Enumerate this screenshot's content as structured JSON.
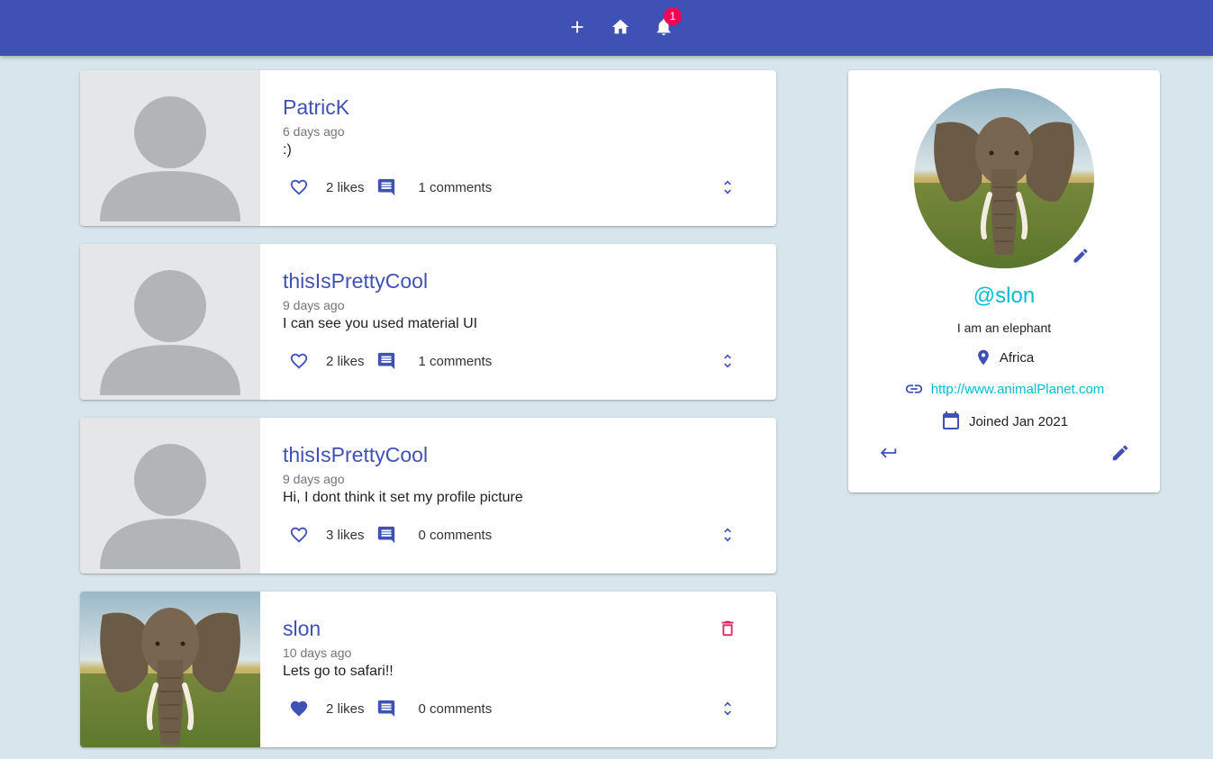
{
  "appbar": {
    "notification_count": "1",
    "icons": [
      "add-icon",
      "home-icon",
      "bell-icon"
    ],
    "color": "#3f51b5"
  },
  "posts": [
    {
      "user": "PatricK",
      "date": "6 days ago",
      "body": ":)",
      "likes": "2 likes",
      "comments": "1 comments",
      "liked": false,
      "owner": false
    },
    {
      "user": "thisIsPrettyCool",
      "date": "9 days ago",
      "body": "I can see you used material UI",
      "likes": "2 likes",
      "comments": "1 comments",
      "liked": false,
      "owner": false
    },
    {
      "user": "thisIsPrettyCool",
      "date": "9 days ago",
      "body": "Hi, I dont think it set my profile picture",
      "likes": "3 likes",
      "comments": "0 comments",
      "liked": false,
      "owner": false
    },
    {
      "user": "slon",
      "date": "10 days ago",
      "body": "Lets go to safari!!",
      "likes": "2 likes",
      "comments": "0 comments",
      "liked": true,
      "owner": true
    }
  ],
  "profile": {
    "handle": "@slon",
    "bio": "I am an elephant",
    "location": "Africa",
    "website": "http://www.animalPlanet.com",
    "joined": "Joined Jan 2021"
  },
  "colors": {
    "primary": "#3f51b5",
    "accent": "#00bcd4",
    "danger": "#e91e63",
    "background": "#d6e6ec"
  }
}
